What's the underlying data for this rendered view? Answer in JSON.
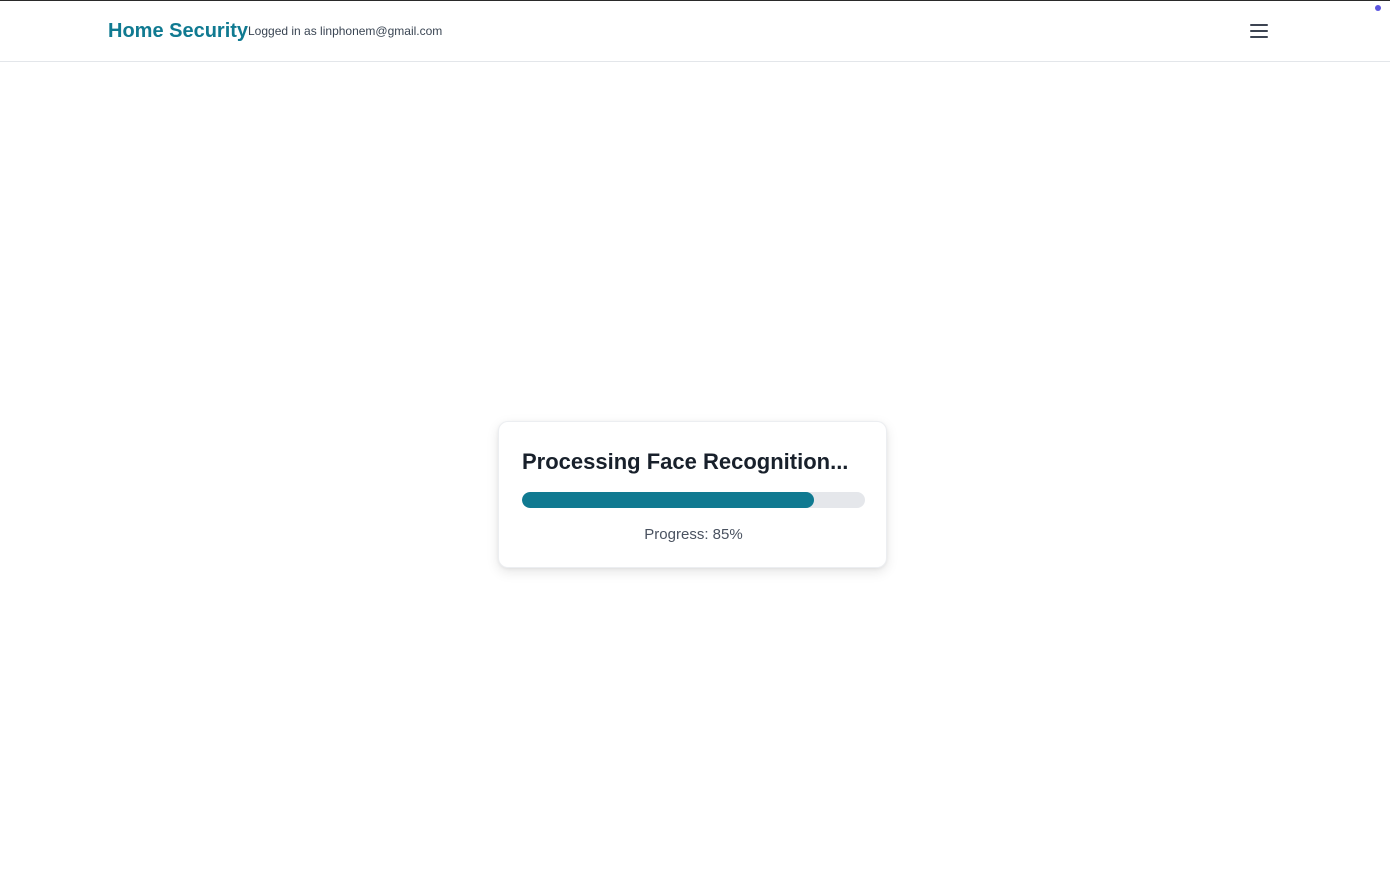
{
  "header": {
    "brand": "Home Security",
    "user_status": "Logged in as linphonem@gmail.com",
    "menu_icon": "hamburger-menu-icon"
  },
  "processing": {
    "title": "Processing Face Recognition...",
    "progress_value": 85,
    "progress_text": "Progress: 85%"
  },
  "colors": {
    "accent": "#107a91",
    "track": "#e5e7eb",
    "status_dot": "#5b55e0"
  }
}
